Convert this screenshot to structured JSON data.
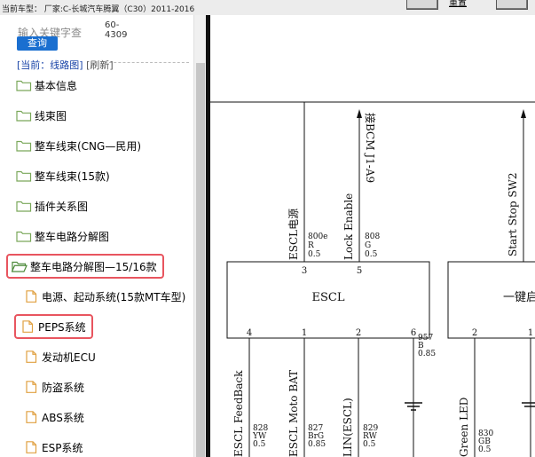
{
  "topbar": {
    "car_info": "当前车型： 厂家:C-长城汽车腾翼（C30）2011-2016",
    "link_label": "重置"
  },
  "sidebar": {
    "search_placeholder": "输入关键字查",
    "search_button": "查询",
    "code_lines": [
      "60-",
      "4309"
    ],
    "breadcrumb_current": "[当前：线路图]",
    "breadcrumb_refresh": "[刷新]",
    "items": [
      {
        "label": "基本信息",
        "type": "folder"
      },
      {
        "label": "线束图",
        "type": "folder"
      },
      {
        "label": "整车线束(CNG—民用)",
        "type": "folder"
      },
      {
        "label": "整车线束(15款)",
        "type": "folder"
      },
      {
        "label": "插件关系图",
        "type": "folder"
      },
      {
        "label": "整车电路分解图",
        "type": "folder"
      },
      {
        "label": "整车电路分解图—15/16款",
        "type": "folder-open",
        "highlighted": true
      },
      {
        "label": "电源、起动系统(15款MT车型)",
        "type": "file"
      },
      {
        "label": "PEPS系统",
        "type": "file",
        "highlighted": true
      },
      {
        "label": "发动机ECU",
        "type": "file"
      },
      {
        "label": "防盗系统",
        "type": "file"
      },
      {
        "label": "ABS系统",
        "type": "file"
      },
      {
        "label": "ESP系统",
        "type": "file"
      }
    ]
  },
  "diagram": {
    "escl_label": "ESCL",
    "right_module_label": "一键启",
    "top_signals": [
      {
        "name": "ESCL电源",
        "pin": "3",
        "wire": [
          "800e",
          "R",
          "0.5"
        ]
      },
      {
        "name": "Lock Enable",
        "pin": "5",
        "wire": [
          "808",
          "G",
          "0.5"
        ]
      },
      {
        "name": "接BCM J1-A9",
        "pin": "",
        "wire": []
      },
      {
        "name": "Start Stop SW2",
        "pin": "",
        "wire": []
      }
    ],
    "bottom_pins": [
      {
        "pin": "4",
        "name": "ESCL FeedBack",
        "wire": [
          "828",
          "YW",
          "0.5"
        ]
      },
      {
        "pin": "1",
        "name": "ESCL Moto BAT",
        "wire": [
          "827",
          "BrG",
          "0.85"
        ]
      },
      {
        "pin": "2",
        "name": "LIN(ESCL)",
        "wire": [
          "829",
          "RW",
          "0.5"
        ]
      },
      {
        "pin": "6",
        "name": "",
        "wire": [
          "957",
          "B",
          "0.85"
        ]
      },
      {
        "pin": "2",
        "name": "Green LED",
        "wire": [
          "830",
          "GB",
          "0.5"
        ]
      },
      {
        "pin": "1",
        "name": "",
        "wire": []
      }
    ],
    "colors": {
      "highlight": "#e8555f",
      "button": "#1a6fd0"
    }
  }
}
